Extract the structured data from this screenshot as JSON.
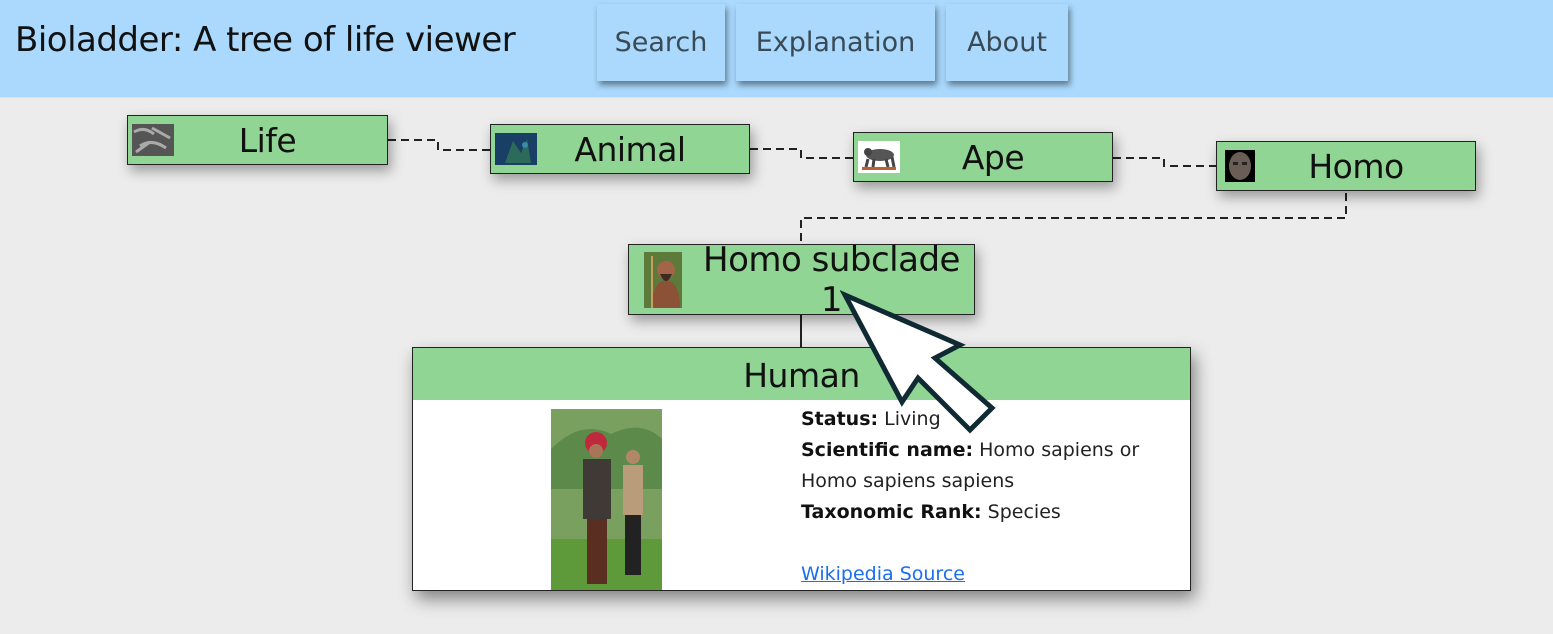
{
  "header": {
    "title": "Bioladder: A tree of life viewer",
    "nav": [
      {
        "label": "Search"
      },
      {
        "label": "Explanation"
      },
      {
        "label": "About"
      }
    ]
  },
  "colors": {
    "header_bg": "#aad9fd",
    "node_bg": "#90d594",
    "page_bg": "#ececec",
    "link": "#1a6ef0"
  },
  "ancestry": [
    {
      "label": "Life",
      "image": "bacteria-thumbnail"
    },
    {
      "label": "Animal",
      "image": "coral-reef-thumbnail"
    },
    {
      "label": "Ape",
      "image": "ape-thumbnail"
    },
    {
      "label": "Homo",
      "image": "homo-skull-thumbnail"
    }
  ],
  "current_node": {
    "label": "Homo subclade 1",
    "image": "early-human-thumbnail"
  },
  "detail_card": {
    "title": "Human",
    "image": "human-photo",
    "fields": [
      {
        "key": "Status:",
        "value": "Living"
      },
      {
        "key": "Scientific name:",
        "value": "Homo sapiens or Homo sapiens sapiens"
      },
      {
        "key": "Taxonomic Rank:",
        "value": "Species"
      }
    ],
    "source_link": "Wikipedia Source"
  }
}
